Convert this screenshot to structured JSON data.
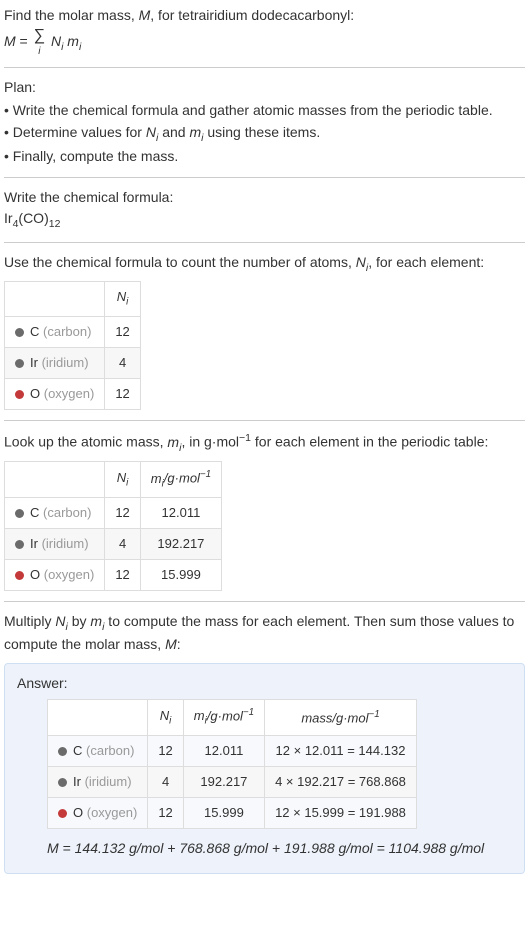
{
  "intro": {
    "line1": "Find the molar mass, M, for tetrairidium dodecacarbonyl:",
    "eq_lhs": "M = ",
    "eq_rhs": " N_i m_i",
    "sigma_below": "i"
  },
  "plan": {
    "heading": "Plan:",
    "items": [
      "• Write the chemical formula and gather atomic masses from the periodic table.",
      "• Determine values for N_i and m_i using these items.",
      "• Finally, compute the mass."
    ]
  },
  "formula": {
    "heading": "Write the chemical formula:",
    "base1": "Ir",
    "sub1": "4",
    "base2": "(CO)",
    "sub2": "12"
  },
  "count": {
    "heading": "Use the chemical formula to count the number of atoms, N_i, for each element:",
    "header_n": "N_i",
    "rows": [
      {
        "color": "#6b6b6b",
        "name": "C",
        "paren": "(carbon)",
        "n": "12"
      },
      {
        "color": "#6b6b6b",
        "name": "Ir",
        "paren": "(iridium)",
        "n": "4"
      },
      {
        "color": "#c43a3a",
        "name": "O",
        "paren": "(oxygen)",
        "n": "12"
      }
    ]
  },
  "lookup": {
    "heading": "Look up the atomic mass, m_i, in g·mol⁻¹ for each element in the periodic table:",
    "header_n": "N_i",
    "header_m": "m_i /g·mol⁻¹",
    "rows": [
      {
        "color": "#6b6b6b",
        "name": "C",
        "paren": "(carbon)",
        "n": "12",
        "m": "12.011"
      },
      {
        "color": "#6b6b6b",
        "name": "Ir",
        "paren": "(iridium)",
        "n": "4",
        "m": "192.217"
      },
      {
        "color": "#c43a3a",
        "name": "O",
        "paren": "(oxygen)",
        "n": "12",
        "m": "15.999"
      }
    ]
  },
  "multiply": {
    "heading": "Multiply N_i by m_i to compute the mass for each element. Then sum those values to compute the molar mass, M:"
  },
  "answer": {
    "label": "Answer:",
    "header_n": "N_i",
    "header_m": "m_i /g·mol⁻¹",
    "header_mass": "mass/g·mol⁻¹",
    "rows": [
      {
        "color": "#6b6b6b",
        "name": "C",
        "paren": "(carbon)",
        "n": "12",
        "m": "12.011",
        "mass": "12 × 12.011 = 144.132"
      },
      {
        "color": "#6b6b6b",
        "name": "Ir",
        "paren": "(iridium)",
        "n": "4",
        "m": "192.217",
        "mass": "4 × 192.217 = 768.868"
      },
      {
        "color": "#c43a3a",
        "name": "O",
        "paren": "(oxygen)",
        "n": "12",
        "m": "15.999",
        "mass": "12 × 15.999 = 191.988"
      }
    ],
    "final": "M = 144.132 g/mol + 768.868 g/mol + 191.988 g/mol = 1104.988 g/mol"
  },
  "chart_data": {
    "type": "table",
    "title": "Molar mass computation for Ir4(CO)12",
    "elements": [
      {
        "element": "C",
        "N_i": 12,
        "m_i_g_per_mol": 12.011,
        "mass_g_per_mol": 144.132
      },
      {
        "element": "Ir",
        "N_i": 4,
        "m_i_g_per_mol": 192.217,
        "mass_g_per_mol": 768.868
      },
      {
        "element": "O",
        "N_i": 12,
        "m_i_g_per_mol": 15.999,
        "mass_g_per_mol": 191.988
      }
    ],
    "molar_mass_g_per_mol": 1104.988
  }
}
